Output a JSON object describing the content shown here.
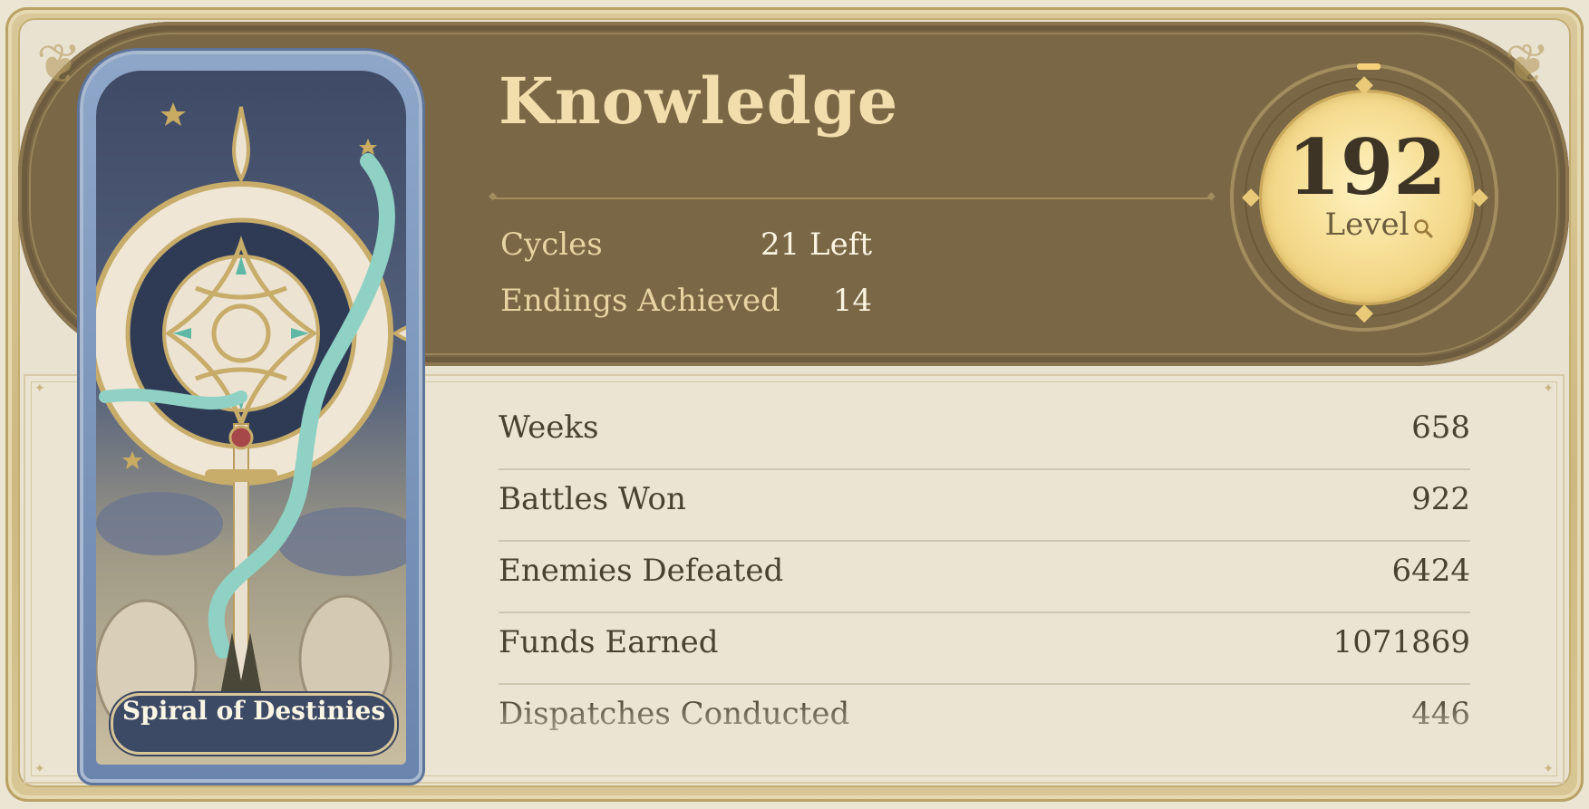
{
  "card": {
    "title": "Spiral of Destinies"
  },
  "header": {
    "title": "Knowledge"
  },
  "info": [
    {
      "label": "Cycles",
      "value": "21 Left"
    },
    {
      "label": "Endings Achieved",
      "value": "14"
    }
  ],
  "level": {
    "value": "192",
    "label": "Level",
    "icon": "magnifier-icon"
  },
  "stats": [
    {
      "label": "Weeks",
      "value": "658"
    },
    {
      "label": "Battles Won",
      "value": "922"
    },
    {
      "label": "Enemies Defeated",
      "value": "6424"
    },
    {
      "label": "Funds Earned",
      "value": "1071869"
    },
    {
      "label": "Dispatches Conducted",
      "value": "446"
    }
  ],
  "colors": {
    "header_band": "#7a6746",
    "title_gold": "#f1deac",
    "medal_gold": "#f6de95",
    "panel_bg": "#ebe4d3",
    "card_blue": "#6b84ad",
    "serpent_teal": "#8fd1c4"
  }
}
